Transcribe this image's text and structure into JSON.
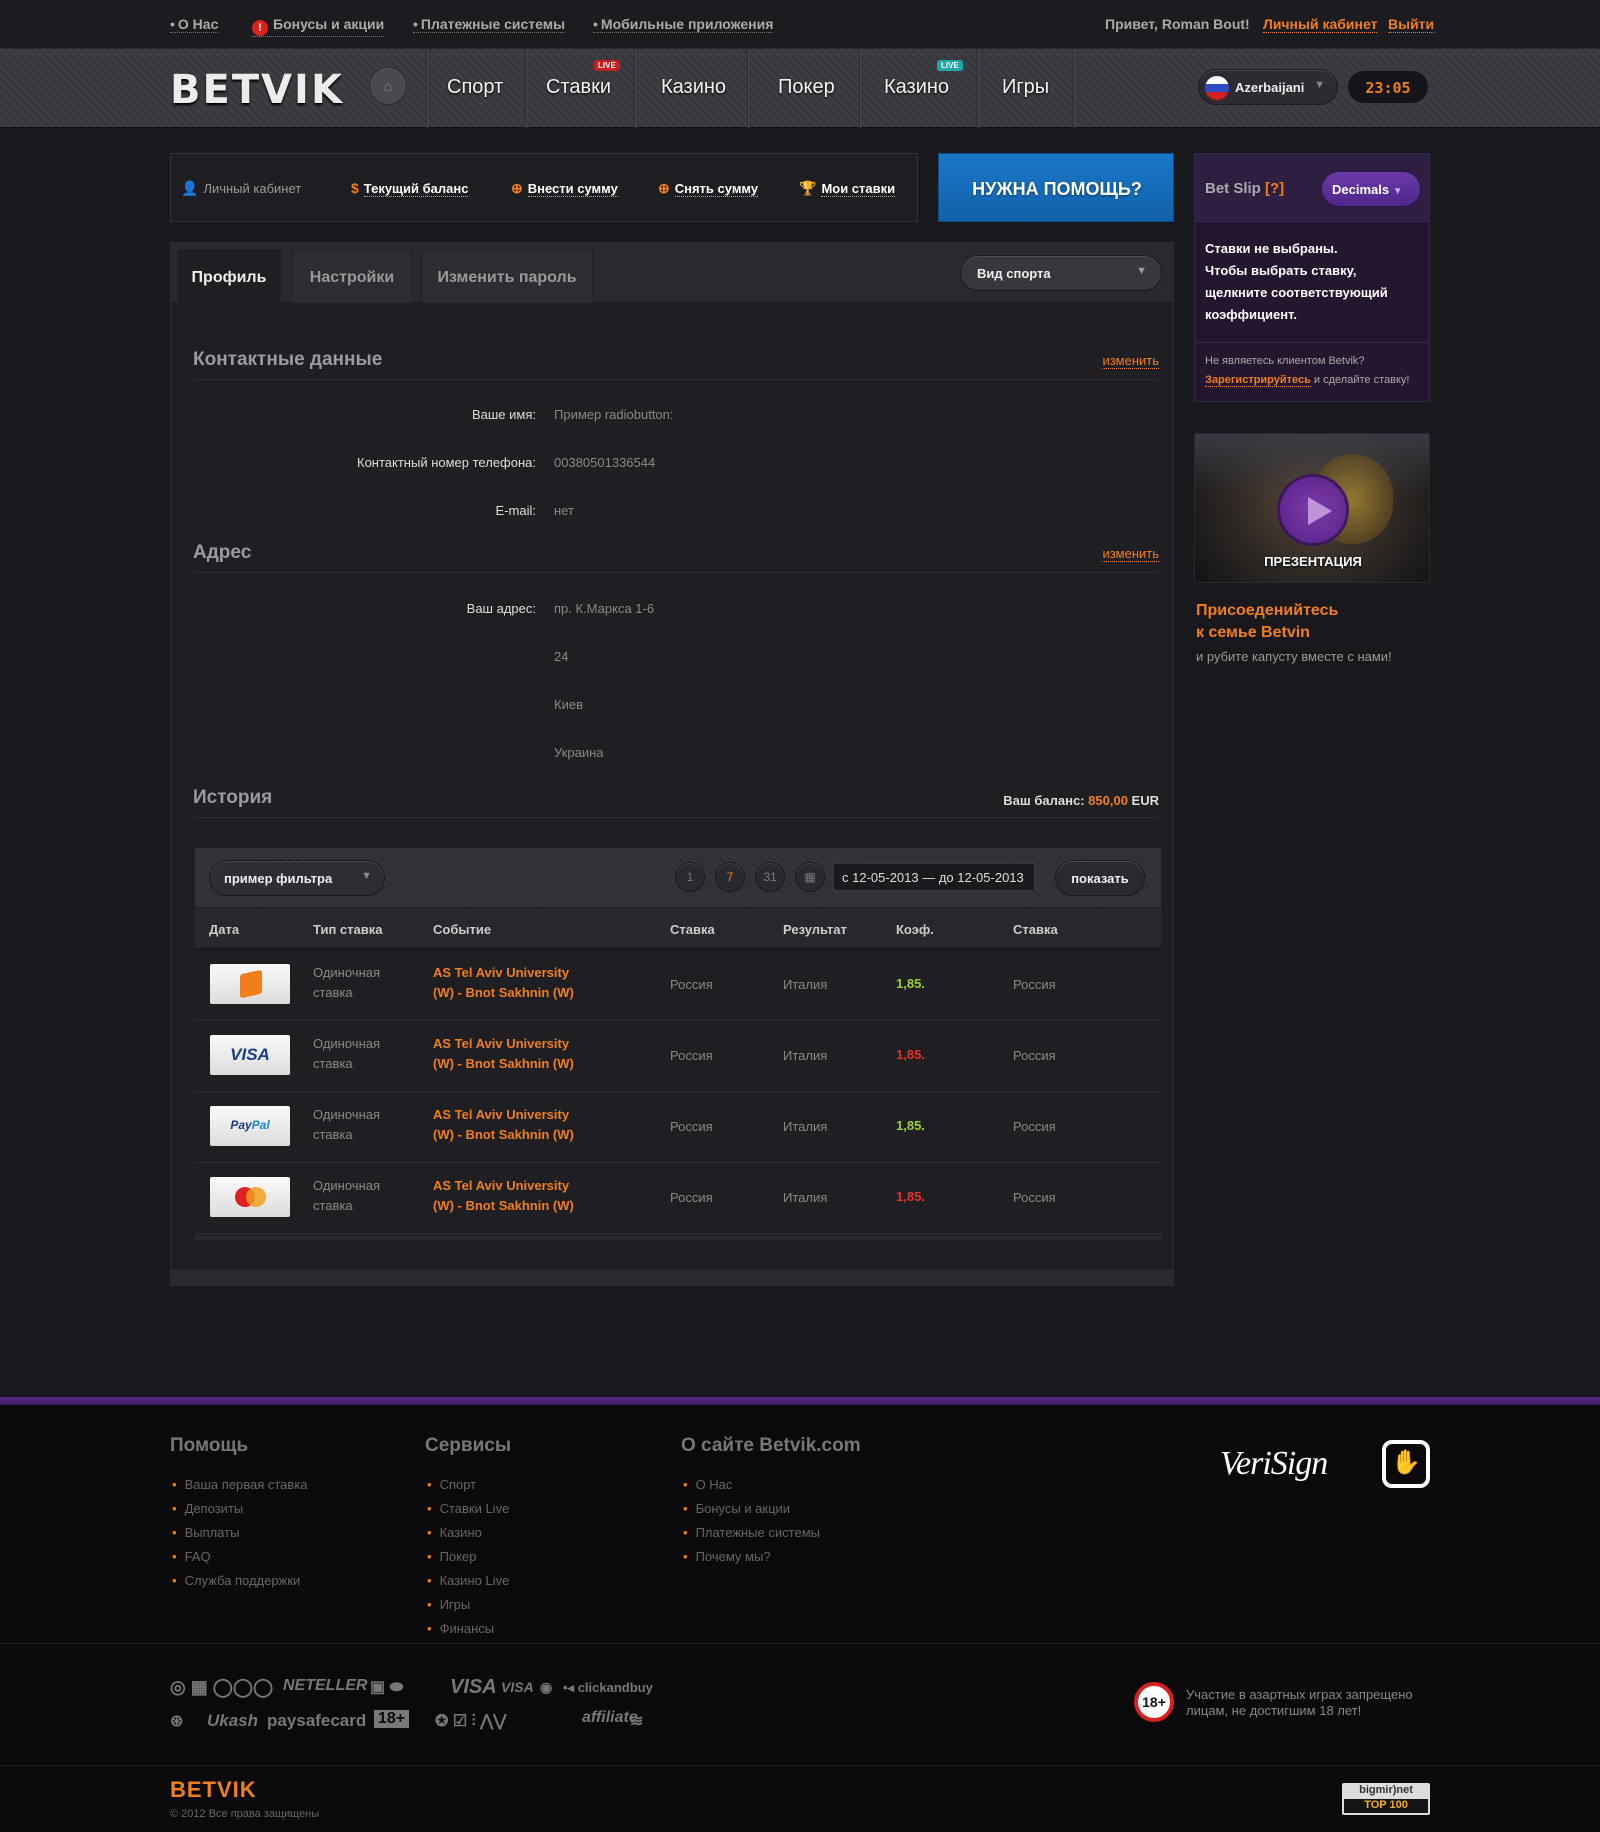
{
  "topbar": {
    "links": [
      "О Нас",
      "Бонусы и акции",
      "Платежные системы",
      "Мобильные приложения"
    ],
    "greeting": "Привет, Roman Bout!",
    "cabinet": "Личный кабинет",
    "logout": "Выйти"
  },
  "header": {
    "logo": "BETVIK",
    "nav": [
      "Спорт",
      "Ставки",
      "Казино",
      "Покер",
      "Казино",
      "Игры"
    ],
    "live_badge": "LIVE",
    "language": "Azerbaijani",
    "clock": "23:05",
    "colors": {
      "accent": "#f07f1a",
      "live_red": "#c82020",
      "live_teal": "#1aa8a8"
    }
  },
  "account": {
    "items": [
      "Личный кабинет",
      "Текущий баланс",
      "Внести сумму",
      "Снять сумму",
      "Мои ставки"
    ],
    "icons": [
      "user-icon",
      "dollar-icon",
      "deposit-icon",
      "withdraw-icon",
      "trophy-icon"
    ],
    "help": "НУЖНА ПОМОЩЬ?"
  },
  "profile": {
    "tabs": [
      "Профиль",
      "Настройки",
      "Изменить пароль"
    ],
    "sport_select": "Вид спорта",
    "edit": "изменить",
    "contact": {
      "title": "Контактные данные",
      "name_label": "Ваше имя:",
      "name_value": "Пример radiobutton:",
      "phone_label": "Контактный номер телефона:",
      "phone_value": "00380501336544",
      "email_label": "E-mail:",
      "email_value": "нет"
    },
    "address": {
      "title": "Адрес",
      "label": "Ваш адрес:",
      "lines": [
        "пр. К.Маркса 1-6",
        "24",
        "Киев",
        "Украина"
      ]
    },
    "history": {
      "title": "История",
      "balance_label": "Ваш баланс:",
      "balance_amount": "850,00",
      "balance_currency": "EUR",
      "filter": "пример фильтра",
      "date_range": "с 12-05-2013 — до 12-05-2013",
      "show": "показать",
      "columns": [
        "Дата",
        "Тип ставка",
        "Событие",
        "Ставка",
        "Результат",
        "Коэф.",
        "Ставка"
      ],
      "rows": [
        {
          "pay": "wallet",
          "type1": "Одиночная",
          "type2": "ставка",
          "event1": "AS Tel Aviv University",
          "event2": "(W) - Bnot Sakhnin (W)",
          "bet": "Россия",
          "result": "Италия",
          "coef": "1,85.",
          "coef_color": "#9bd12e",
          "stake": "Россия"
        },
        {
          "pay": "VISA",
          "type1": "Одиночная",
          "type2": "ставка",
          "event1": "AS Tel Aviv University",
          "event2": "(W) - Bnot Sakhnin (W)",
          "bet": "Россия",
          "result": "Италия",
          "coef": "1,85.",
          "coef_color": "#e8302a",
          "stake": "Россия"
        },
        {
          "pay": "PayPal",
          "type1": "Одиночная",
          "type2": "ставка",
          "event1": "AS Tel Aviv University",
          "event2": "(W) - Bnot Sakhnin (W)",
          "bet": "Россия",
          "result": "Италия",
          "coef": "1,85.",
          "coef_color": "#9bd12e",
          "stake": "Россия"
        },
        {
          "pay": "mastercard",
          "type1": "Одиночная",
          "type2": "ставка",
          "event1": "AS Tel Aviv University",
          "event2": "(W) - Bnot Sakhnin (W)",
          "bet": "Россия",
          "result": "Италия",
          "coef": "1,85.",
          "coef_color": "#e8302a",
          "stake": "Россия"
        }
      ]
    }
  },
  "betslip": {
    "title": "Bet Slip",
    "help": "[?]",
    "decimals": "Decimals",
    "empty": [
      "Ставки не выбраны.",
      "Чтобы выбрать ставку,",
      "щелкните соответствующий",
      "коэффициент."
    ],
    "not_client": "Не являетесь клиентом Betvik?",
    "register": "Зарегистрируйтесь",
    "register_tail": " и сделайте ставку!"
  },
  "promo": {
    "caption": "ПРЕЗЕНТАЦИЯ",
    "join1": "Присоеденийтесь",
    "join2": "к семье Betvin",
    "join3": "и рубите капусту вместе с нами!"
  },
  "footer": {
    "help_title": "Помощь",
    "help_items": [
      "Ваша первая ставка",
      "Депозиты",
      "Выплаты",
      "FAQ",
      "Служба поддержки"
    ],
    "services_title": "Сервисы",
    "services_items": [
      "Спорт",
      "Ставки Live",
      "Казино",
      "Покер",
      "Казино Live",
      "Игры",
      "Финансы"
    ],
    "about_title": "О сайте Betvik.com",
    "about_items": [
      "О Нас",
      "Бонусы и акции",
      "Платежные системы",
      "Почему мы?"
    ],
    "verisign": "VeriSign",
    "payments_row1": [
      "NETELLER",
      "VISA",
      "VISA",
      "clickandbuy"
    ],
    "payments_row2": [
      "Ukash",
      "paysafecard",
      "18+",
      "affiliate"
    ],
    "age_badge": "18+",
    "age_text": "Участие в азартных играх запрещено лицам, не достигшим 18 лет!",
    "logo": "BETVIK",
    "copyright": "© 2012 Все права защищены",
    "counter1": "bigmir)net",
    "counter2": "TOP 100"
  }
}
